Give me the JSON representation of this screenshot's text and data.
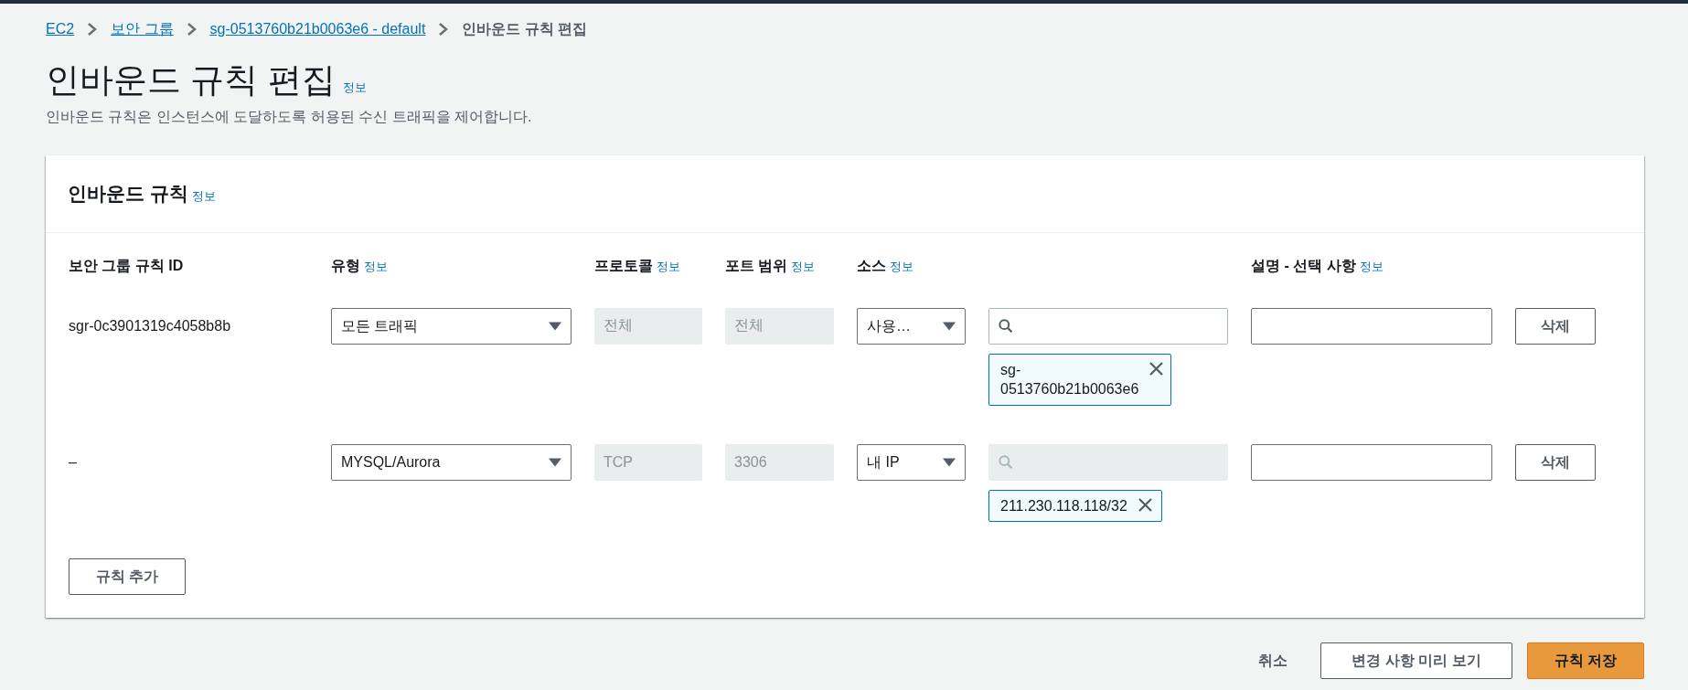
{
  "breadcrumbs": [
    {
      "label": "EC2",
      "current": false
    },
    {
      "label": "보안 그룹",
      "current": false
    },
    {
      "label": "sg-0513760b21b0063e6 - default",
      "current": false
    },
    {
      "label": "인바운드 규칙 편집",
      "current": true
    }
  ],
  "page": {
    "title": "인바운드 규칙 편집",
    "info": "정보",
    "description": "인바운드 규칙은 인스턴스에 도달하도록 허용된 수신 트래픽을 제어합니다."
  },
  "panel": {
    "title": "인바운드 규칙",
    "info": "정보",
    "columns": [
      {
        "label": "보안 그룹 규칙 ID"
      },
      {
        "label": "유형",
        "info": "정보"
      },
      {
        "label": "프로토콜",
        "info": "정보"
      },
      {
        "label": "포트 범위",
        "info": "정보"
      },
      {
        "label": "소스",
        "info": "정보",
        "kind": "source"
      },
      {
        "label": "설명 - 선택 사항",
        "info": "정보"
      }
    ],
    "rules": [
      {
        "id": "sgr-0c3901319c4058b8b",
        "type": "모든 트래픽",
        "protocol": "전체",
        "port": "전체",
        "source": "사용…",
        "search_disabled": false,
        "tokens": [
          "sg-0513760b21b0063e6"
        ],
        "delete": "삭제"
      },
      {
        "id": "–",
        "type": "MYSQL/Aurora",
        "protocol": "TCP",
        "port": "3306",
        "source": "내 IP",
        "search_disabled": true,
        "tokens": [
          "211.230.118.118/32"
        ],
        "delete": "삭제"
      }
    ],
    "add_button": "규칙 추가"
  },
  "footer": [
    {
      "label": "취소",
      "kind": "link"
    },
    {
      "label": "변경 사항 미리 보기",
      "kind": "normal"
    },
    {
      "label": "규칙 저장",
      "kind": "primary"
    }
  ]
}
